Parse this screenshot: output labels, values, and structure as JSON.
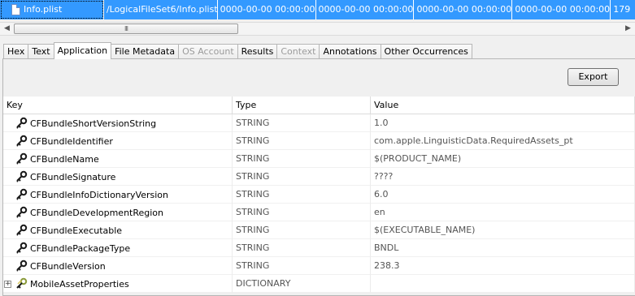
{
  "file_row": {
    "name": "Info.plist",
    "path": "/LogicalFileSet6/Info.plist",
    "dates": [
      "0000-00-00 00:00:00",
      "0000-00-00 00:00:00",
      "0000-00-00 00:00:00",
      "0000-00-00 00:00:00"
    ],
    "size": "179"
  },
  "scrollbar": {
    "left_arrow": "◀",
    "right_arrow": "▶",
    "grip": "III"
  },
  "tabs": [
    {
      "label": "Hex",
      "state": "normal"
    },
    {
      "label": "Text",
      "state": "normal"
    },
    {
      "label": "Application",
      "state": "active"
    },
    {
      "label": "File Metadata",
      "state": "normal"
    },
    {
      "label": "OS Account",
      "state": "disabled"
    },
    {
      "label": "Results",
      "state": "normal"
    },
    {
      "label": "Context",
      "state": "disabled"
    },
    {
      "label": "Annotations",
      "state": "normal"
    },
    {
      "label": "Other Occurrences",
      "state": "normal"
    }
  ],
  "export_label": "Export",
  "table": {
    "headers": {
      "key": "Key",
      "type": "Type",
      "value": "Value"
    },
    "rows": [
      {
        "key": "CFBundleShortVersionString",
        "type": "STRING",
        "value": "1.0",
        "icon": "key-icon"
      },
      {
        "key": "CFBundleIdentifier",
        "type": "STRING",
        "value": "com.apple.LinguisticData.RequiredAssets_pt",
        "icon": "key-icon"
      },
      {
        "key": "CFBundleName",
        "type": "STRING",
        "value": "$(PRODUCT_NAME)",
        "icon": "key-icon"
      },
      {
        "key": "CFBundleSignature",
        "type": "STRING",
        "value": "????",
        "icon": "key-icon"
      },
      {
        "key": "CFBundleInfoDictionaryVersion",
        "type": "STRING",
        "value": "6.0",
        "icon": "key-icon"
      },
      {
        "key": "CFBundleDevelopmentRegion",
        "type": "STRING",
        "value": "en",
        "icon": "key-icon"
      },
      {
        "key": "CFBundleExecutable",
        "type": "STRING",
        "value": "$(EXECUTABLE_NAME)",
        "icon": "key-icon"
      },
      {
        "key": "CFBundlePackageType",
        "type": "STRING",
        "value": "BNDL",
        "icon": "key-icon"
      },
      {
        "key": "CFBundleVersion",
        "type": "STRING",
        "value": "238.3",
        "icon": "key-icon"
      },
      {
        "key": "MobileAssetProperties",
        "type": "DICTIONARY",
        "value": "",
        "icon": "key-group-icon",
        "expandable": true,
        "expander": "+"
      }
    ]
  },
  "colors": {
    "selection": "#3399ff",
    "key_icon": "#1a1a1a",
    "key_group_icon": "#8a9a3a"
  }
}
